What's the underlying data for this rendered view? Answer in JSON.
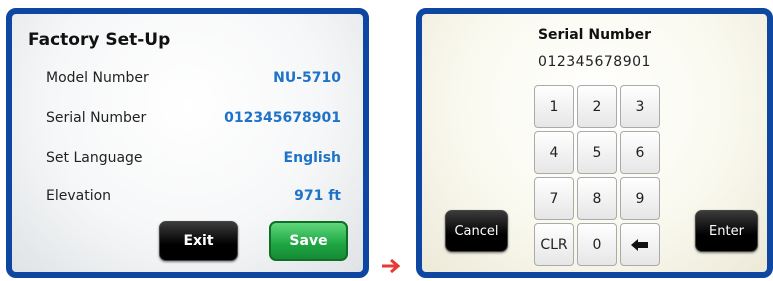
{
  "factory_setup": {
    "title": "Factory Set-Up",
    "rows": [
      {
        "label": "Model Number",
        "value": "NU-5710"
      },
      {
        "label": "Serial Number",
        "value": "012345678901"
      },
      {
        "label": "Set Language",
        "value": "English"
      },
      {
        "label": "Elevation",
        "value": "971 ft"
      }
    ],
    "exit_label": "Exit",
    "save_label": "Save"
  },
  "keypad_screen": {
    "title": "Serial Number",
    "value": "012345678901",
    "keys": [
      "1",
      "2",
      "3",
      "4",
      "5",
      "6",
      "7",
      "8",
      "9",
      "CLR",
      "0"
    ],
    "backspace_icon": "backspace-arrow-icon",
    "cancel_label": "Cancel",
    "enter_label": "Enter"
  },
  "colors": {
    "frame_blue": "#0d47a1",
    "value_blue": "#1e72c8",
    "save_green": "#1ea542",
    "arrow_red": "#e53935"
  }
}
